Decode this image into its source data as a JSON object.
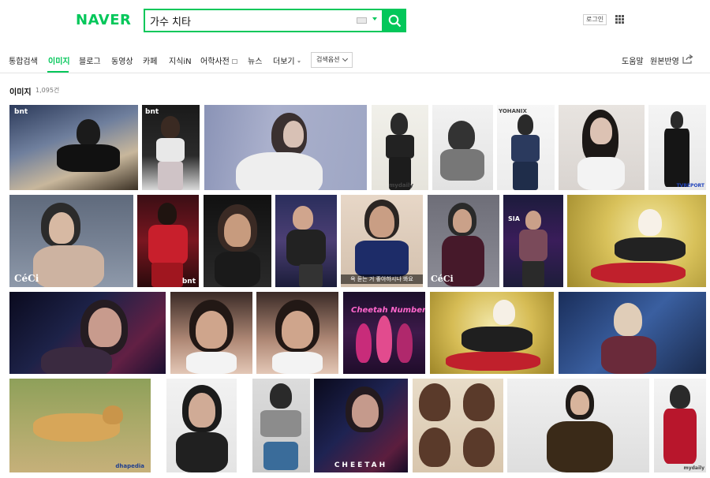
{
  "header": {
    "logo": "NAVER",
    "search_value": "가수 치타",
    "login_label": "로그인",
    "icons": {
      "search": "search-icon",
      "keyboard": "keyboard-icon",
      "apps": "grid-menu-icon"
    }
  },
  "nav": {
    "tabs": [
      {
        "label": "통합검색",
        "active": false
      },
      {
        "label": "이미지",
        "active": true
      },
      {
        "label": "블로그",
        "active": false
      },
      {
        "label": "동영상",
        "active": false
      },
      {
        "label": "카페",
        "active": false
      },
      {
        "label": "지식iN",
        "active": false
      },
      {
        "label": "어학사전",
        "active": false
      },
      {
        "label": "뉴스",
        "active": false
      },
      {
        "label": "더보기",
        "active": false
      }
    ],
    "option_label": "검색옵션",
    "help_label": "도움말",
    "feedback_label": "원본반영"
  },
  "section": {
    "title": "이미지",
    "count": "1,095건"
  },
  "images": [
    {
      "overlay": "bnt"
    },
    {
      "overlay": "bnt"
    },
    {
      "overlay": ""
    },
    {
      "overlay": "mydaily"
    },
    {
      "overlay": ""
    },
    {
      "overlay": "YOHANIX"
    },
    {
      "overlay": ""
    },
    {
      "overlay": "TVREPORT"
    },
    {
      "overlay": "CéCi"
    },
    {
      "overlay": "bnt"
    },
    {
      "overlay": ""
    },
    {
      "overlay": ""
    },
    {
      "overlay": "욕 듣는 거 좋아하시나 봐요"
    },
    {
      "overlay": "CéCi"
    },
    {
      "overlay": "SIA"
    },
    {
      "overlay": ""
    },
    {
      "overlay": ""
    },
    {
      "overlay": ""
    },
    {
      "overlay": ""
    },
    {
      "overlay": "Cheetah Number"
    },
    {
      "overlay": ""
    },
    {
      "overlay": ""
    },
    {
      "overlay": "dhapedia"
    },
    {
      "overlay": ""
    },
    {
      "overlay": ""
    },
    {
      "overlay": "CHEETAH"
    },
    {
      "overlay": ""
    },
    {
      "overlay": ""
    },
    {
      "overlay": "mydaily"
    }
  ],
  "colors": {
    "brand": "#03c75a"
  }
}
